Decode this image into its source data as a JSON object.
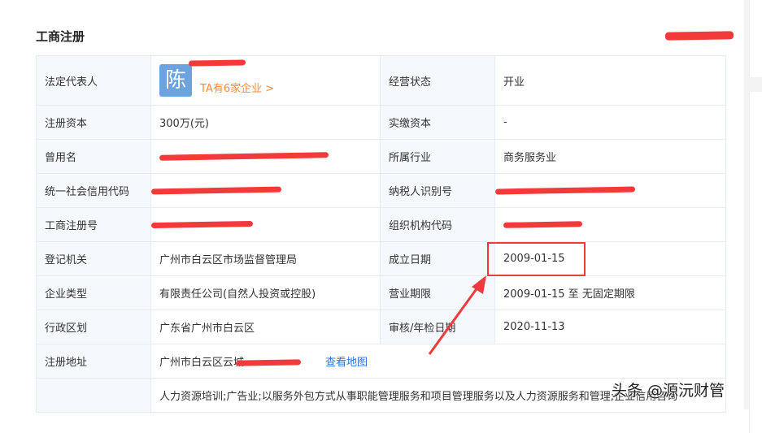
{
  "section_title": "工商注册",
  "rows": [
    {
      "l1": "法定代表人",
      "l2": "经营状态",
      "v2": "开业"
    },
    {
      "l1": "注册资本",
      "v1": "300万(元)",
      "l2": "实缴资本",
      "v2": "-"
    },
    {
      "l1": "曾用名",
      "l2": "所属行业",
      "v2": "商务服务业"
    },
    {
      "l1": "统一社会信用代码",
      "l2": "纳税人识别号"
    },
    {
      "l1": "工商注册号",
      "l2": "组织机构代码"
    },
    {
      "l1": "登记机关",
      "v1": "广州市白云区市场监督管理局",
      "l2": "成立日期",
      "v2": "2009-01-15"
    },
    {
      "l1": "企业类型",
      "v1": "有限责任公司(自然人投资或控股)",
      "l2": "营业期限",
      "v2": "2009-01-15 至 无固定期限"
    },
    {
      "l1": "行政区划",
      "v1": "广东省广州市白云区",
      "l2": "审核/年检日期",
      "v2": "2020-11-13"
    },
    {
      "l1": "注册地址",
      "v1": "广州市白云区云城",
      "map_link": "查看地图"
    },
    {
      "l1": "",
      "v1": "人力资源培训;广告业;以服务外包方式从事职能管理服务和项目管理服务以及人力资源服务和管理;企业信用咨询"
    }
  ],
  "legal_rep": {
    "avatar_char": "陈",
    "companies_link": "TA有6家企业 >"
  },
  "watermark": "头条 @源沅财管",
  "colors": {
    "annotation": "#ef3b3b",
    "link": "#2f6fe0",
    "orange": "#f38b3c"
  }
}
